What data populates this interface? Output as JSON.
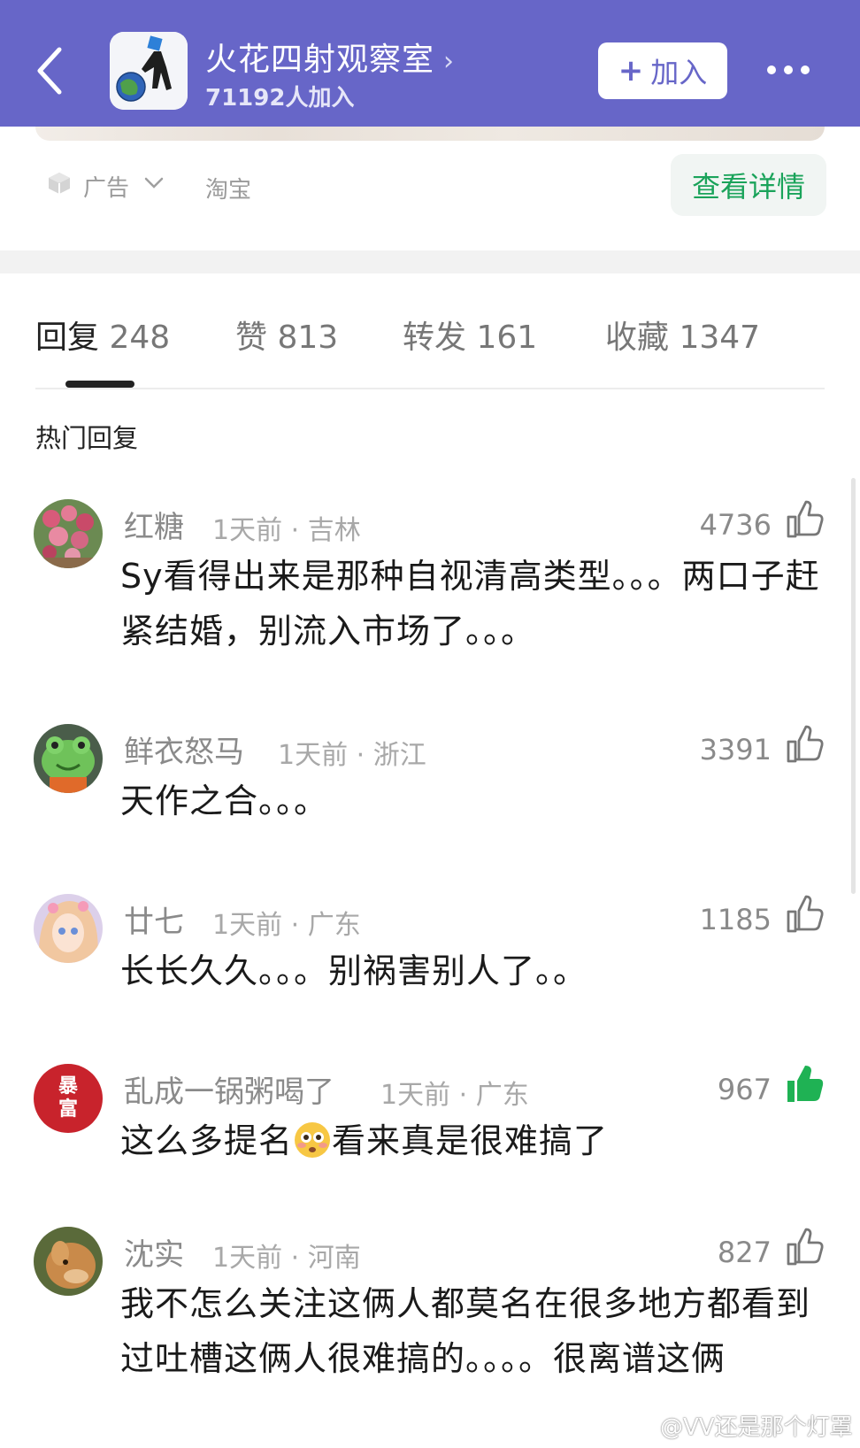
{
  "header": {
    "group_name": "火花四射观察室",
    "member_count": "71192人加入",
    "join_label": "加入",
    "bg_color": "#6766c8"
  },
  "ad": {
    "label": "广告",
    "source": "淘宝",
    "detail_button": "查看详情"
  },
  "tabs": [
    {
      "label": "回复",
      "count": "248",
      "active": true
    },
    {
      "label": "赞",
      "count": "813"
    },
    {
      "label": "转发",
      "count": "161"
    },
    {
      "label": "收藏",
      "count": "1347"
    }
  ],
  "section_title": "热门回复",
  "comments": [
    {
      "user": "红糖",
      "time": "1天前",
      "location": "吉林",
      "likes": "4736",
      "liked": false,
      "text": "Sy看得出来是那种自视清高类型。。。两口子赶紧结婚，别流入市场了。。。"
    },
    {
      "user": "鲜衣怒马",
      "time": "1天前",
      "location": "浙江",
      "likes": "3391",
      "liked": false,
      "text": "天作之合。。。"
    },
    {
      "user": "廿七",
      "time": "1天前",
      "location": "广东",
      "likes": "1185",
      "liked": false,
      "text": "长长久久。。。别祸害别人了。。"
    },
    {
      "user": "乱成一锅粥喝了",
      "time": "1天前",
      "location": "广东",
      "likes": "967",
      "liked": true,
      "text_before": "这么多提名",
      "text_after": "看来真是很难搞了",
      "emoji": "flushed-face-icon",
      "avatar_text": "暴富"
    },
    {
      "user": "沈实",
      "time": "1天前",
      "location": "河南",
      "likes": "827",
      "liked": false,
      "text": "我不怎么关注这俩人都莫名在很多地方都看到过吐槽这俩人很难搞的。。。。很离谱这俩"
    }
  ],
  "watermark": "@VV还是那个灯罩",
  "colors": {
    "like_active": "#1fb254",
    "ad_button_text": "#1aa35a"
  }
}
